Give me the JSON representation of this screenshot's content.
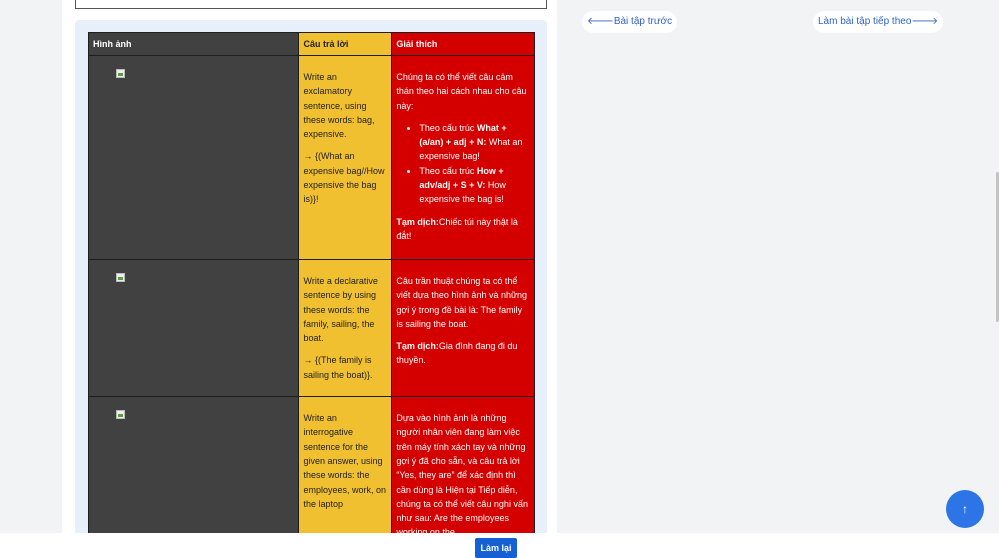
{
  "table": {
    "headers": {
      "image": "Hình ảnh",
      "answer": "Câu trả lời",
      "explanation": "Giải thích"
    },
    "rows": [
      {
        "answer_p1": "Write an exclamatory sentence, using these words: bag, expensive.",
        "answer_p2": "→ {(What an expensive bag//How expensive the bag is)}!",
        "exp_intro": "Chúng ta có thể viết câu cảm thán theo hai cách nhau cho câu này:",
        "exp_b1_prefix": "Theo cấu trúc ",
        "exp_b1_bold": "What + (a/an) + adj + N:",
        "exp_b1_rest": " What an expensive bag!",
        "exp_b2_prefix": "Theo cấu trúc ",
        "exp_b2_bold": "How + adv/adj + S + V:",
        "exp_b2_rest": " How expensive the bag is!",
        "trans_label": "Tạm dịch:",
        "trans_text": "Chiếc túi này thật là đắt!"
      },
      {
        "answer_p1": "Write a declarative sentence by using these words: the family, sailing, the boat.",
        "answer_p2": "→ {(The family is sailing the boat)}.",
        "exp_intro": "Câu trần thuật chúng ta có thể viết dựa theo hình ảnh và những gợi ý trong đề bài là: The family is sailing the boat.",
        "trans_label": "Tạm dịch:",
        "trans_text": "Gia đình đang đi du thuyền."
      },
      {
        "answer_p1": "Write an interrogative sentence for the given answer, using these words: the employees, work, on the laptop",
        "exp_intro": "Dựa vào hình ảnh là những người nhân viên đang làm việc trên máy tính xách tay và những gợi ý đã cho sẵn, và câu trả lời “Yes, they are” để xác định thì cần dùng là Hiện tại Tiếp diễn, chúng ta có thể viết câu nghi vấn như sau: Are the employees working on the"
      }
    ]
  },
  "nav": {
    "prev": "🡐Bài tập trước",
    "next": "Làm bài tập tiếp theo🡒"
  },
  "footer": {
    "retry": "Làm lại"
  },
  "scroll_top": {
    "label": "↑"
  },
  "colors": {
    "answer_col": "#f0c030",
    "explanation_col": "#d40000",
    "image_col": "#414141",
    "primary": "#1560d4"
  }
}
